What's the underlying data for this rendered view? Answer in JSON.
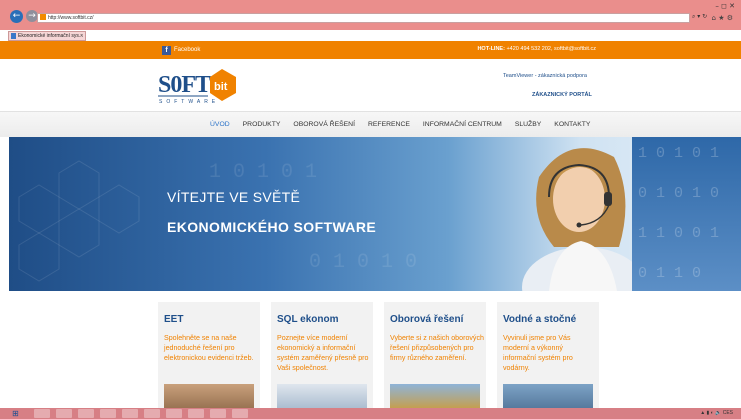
{
  "browser": {
    "back": "←",
    "forward": "→",
    "address": "http://www.softbit.cz/",
    "address_tools": "⌕ ▾ ↻",
    "window_controls": "–  ◻  ✕",
    "right_icons": "⌂ ★ ⚙",
    "tab_title": "Ekonomické informační sys...",
    "tab_close": "×"
  },
  "topbar": {
    "facebook_icon": "f",
    "facebook": "Facebook",
    "hotline_label": "HOT-LINE:",
    "hotline_value": "+420 494 532 202, softbit@softbit.cz"
  },
  "header": {
    "teamviewer": "TeamViewer - zákaznická podpora",
    "portal": "ZÁKAZNICKÝ PORTÁL",
    "logo_word": "SOFTbit",
    "logo_sub": "SOFTWARE"
  },
  "menu": [
    "ÚVOD",
    "PRODUKTY",
    "OBOROVÁ ŘEŠENÍ",
    "REFERENCE",
    "INFORMAČNÍ CENTRUM",
    "SLUŽBY",
    "KONTAKTY"
  ],
  "hero": {
    "line1": "VÍTEJTE VE SVĚTĚ",
    "line2": "EKONOMICKÉHO SOFTWARE",
    "digits": [
      "1 0 1 0 1",
      "0 1 0 1 0",
      "1 1 0 0 1",
      "0 1 1 0"
    ]
  },
  "cards": [
    {
      "title": "EET",
      "text": "Spolehněte se na naše jednoduché řešení pro elektronickou evidenci tržeb."
    },
    {
      "title": "SQL ekonom",
      "text": "Poznejte více moderní ekonomický a informační systém zaměřený přesně pro Vaši společnost."
    },
    {
      "title": "Oborová řešení",
      "text": "Vyberte si z našich oborových řešení přizpůsobených pro firmy různého zaměření."
    },
    {
      "title": "Vodné a stočné",
      "text": "Vyvinuli jsme pro Vás moderní a výkonný informační systém pro vodárny."
    }
  ],
  "taskbar": {
    "start": "⊞",
    "tray": "▲ ▮ ◐ 🔈 CES"
  },
  "colors": {
    "orange": "#f08200",
    "navy": "#1f4f8a",
    "menu_active": "#2a72c8"
  }
}
